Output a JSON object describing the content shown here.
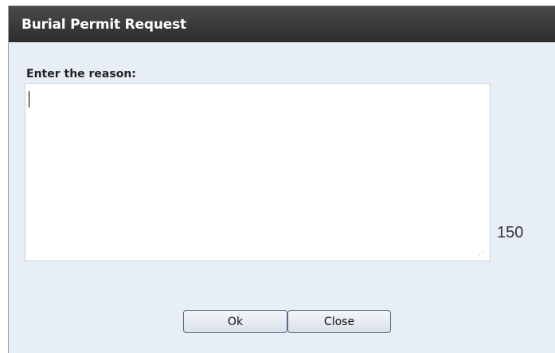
{
  "dialog": {
    "title": "Burial Permit Request",
    "prompt_label": "Enter the reason:",
    "reason_value": "",
    "char_count": "150",
    "ok_label": "Ok",
    "close_label": "Close"
  }
}
